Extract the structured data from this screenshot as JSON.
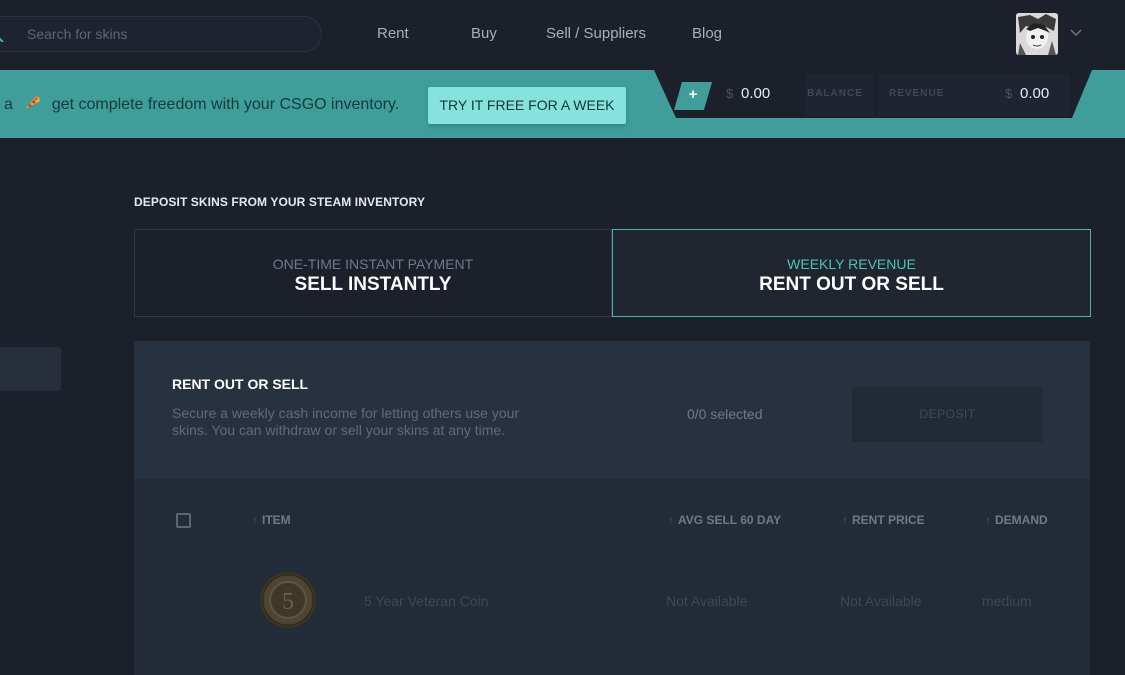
{
  "nav": {
    "search_placeholder": "Search for skins",
    "links": [
      "Rent",
      "Buy",
      "Sell / Suppliers",
      "Blog"
    ]
  },
  "banner": {
    "text_prefix": "a",
    "text_main": "get complete freedom with your CSGO inventory.",
    "cta_label": "TRY IT FREE FOR A WEEK"
  },
  "balance": {
    "plus_label": "+",
    "currency": "$",
    "balance_amount": "0.00",
    "balance_label": "BALANCE",
    "revenue_label": "REVENUE",
    "revenue_amount": "0.00"
  },
  "deposit": {
    "title": "DEPOSIT SKINS FROM YOUR STEAM INVENTORY",
    "modes": [
      {
        "sub": "ONE-TIME INSTANT PAYMENT",
        "main": "SELL INSTANTLY",
        "active": false
      },
      {
        "sub": "WEEKLY REVENUE",
        "main": "RENT OUT OR SELL",
        "active": true
      }
    ]
  },
  "panel": {
    "title": "RENT OUT OR SELL",
    "description": "Secure a weekly cash income for letting others use your skins. You can withdraw or sell your skins at any time.",
    "selected": "0/0 selected",
    "deposit_label": "DEPOSIT"
  },
  "table": {
    "columns": [
      "ITEM",
      "AVG SELL 60 DAY",
      "RENT PRICE",
      "DEMAND"
    ],
    "sort_arrow": "↑",
    "rows": [
      {
        "item": "5 Year Veteran Coin",
        "avg_sell": "Not Available",
        "rent_price": "Not Available",
        "demand": "medium",
        "coin_number": "5"
      }
    ]
  },
  "colors": {
    "accent": "#3f9e99",
    "accent_light": "#86e2dc",
    "background": "#1b202a",
    "panel": "#283140"
  }
}
